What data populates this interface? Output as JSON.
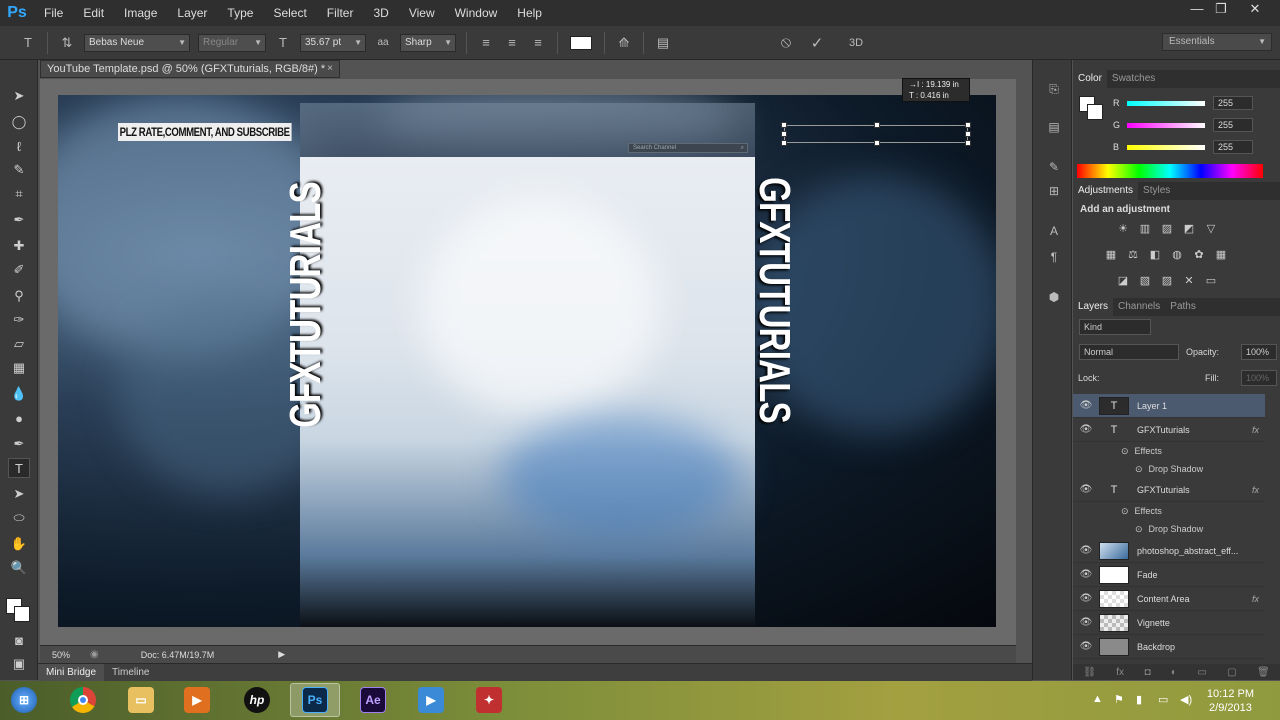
{
  "app": {
    "logo": "Ps"
  },
  "menu": [
    "File",
    "Edit",
    "Image",
    "Layer",
    "Type",
    "Select",
    "Filter",
    "3D",
    "View",
    "Window",
    "Help"
  ],
  "window_controls": {
    "minimize": "—",
    "maximize": "❐",
    "close": "✕"
  },
  "options": {
    "font_family": "Bebas Neue",
    "font_style": "Regular",
    "font_size": "35.67 pt",
    "aa_label": "aa",
    "antialias": "Sharp",
    "cancel_icon": "⦸",
    "commit_icon": "✓",
    "threed": "3D",
    "workspace": "Essentials"
  },
  "document": {
    "tab_title": "YouTube Template.psd @ 50% (GFXTuturials, RGB/8#) *",
    "close": "×"
  },
  "canvas": {
    "plz_text": "PLZ RATE,COMMENT, AND SUBSCRIBE",
    "search_placeholder": "Search Channel",
    "left_text": "GFXTUTURIALS",
    "right_text": "GFXTUTURIALS",
    "info_line1": "→I : 19.139 in",
    "info_line2": "T : 0.416 in"
  },
  "status": {
    "zoom": "50%",
    "doc": "Doc: 6.47M/19.7M"
  },
  "bottom_tabs": [
    "Mini Bridge",
    "Timeline"
  ],
  "color_panel": {
    "tabs": [
      "Color",
      "Swatches"
    ],
    "r": {
      "label": "R",
      "value": "255"
    },
    "g": {
      "label": "G",
      "value": "255"
    },
    "b": {
      "label": "B",
      "value": "255"
    }
  },
  "adjustments_panel": {
    "tabs": [
      "Adjustments",
      "Styles"
    ],
    "title": "Add an adjustment"
  },
  "layers_panel": {
    "tabs": [
      "Layers",
      "Channels",
      "Paths"
    ],
    "filter_kind": "Kind",
    "blend_mode": "Normal",
    "opacity_label": "Opacity:",
    "opacity_value": "100%",
    "lock_label": "Lock:",
    "fill_label": "Fill:",
    "fill_value": "100%",
    "layers": [
      {
        "name": "Layer 1",
        "thumb": "T",
        "selected": true,
        "fx": ""
      },
      {
        "name": "GFXTuturials",
        "thumb": "T",
        "fx": "fx"
      },
      {
        "name": "Effects",
        "sub": true
      },
      {
        "name": "Drop Shadow",
        "sub2": true
      },
      {
        "name": "GFXTuturials",
        "thumb": "T",
        "fx": "fx"
      },
      {
        "name": "Effects",
        "sub": true
      },
      {
        "name": "Drop Shadow",
        "sub2": true
      },
      {
        "name": "photoshop_abstract_eff...",
        "thumb": "img"
      },
      {
        "name": "Fade",
        "thumb": "white"
      },
      {
        "name": "Content Area",
        "thumb": "checker",
        "fx": "fx"
      },
      {
        "name": "Vignette",
        "thumb": "checker"
      },
      {
        "name": "Backdrop",
        "thumb": "gray"
      }
    ]
  },
  "taskbar": {
    "time": "10:12 PM",
    "date": "2/9/2013",
    "hp": "hp",
    "ps": "Ps",
    "ae": "Ae"
  }
}
